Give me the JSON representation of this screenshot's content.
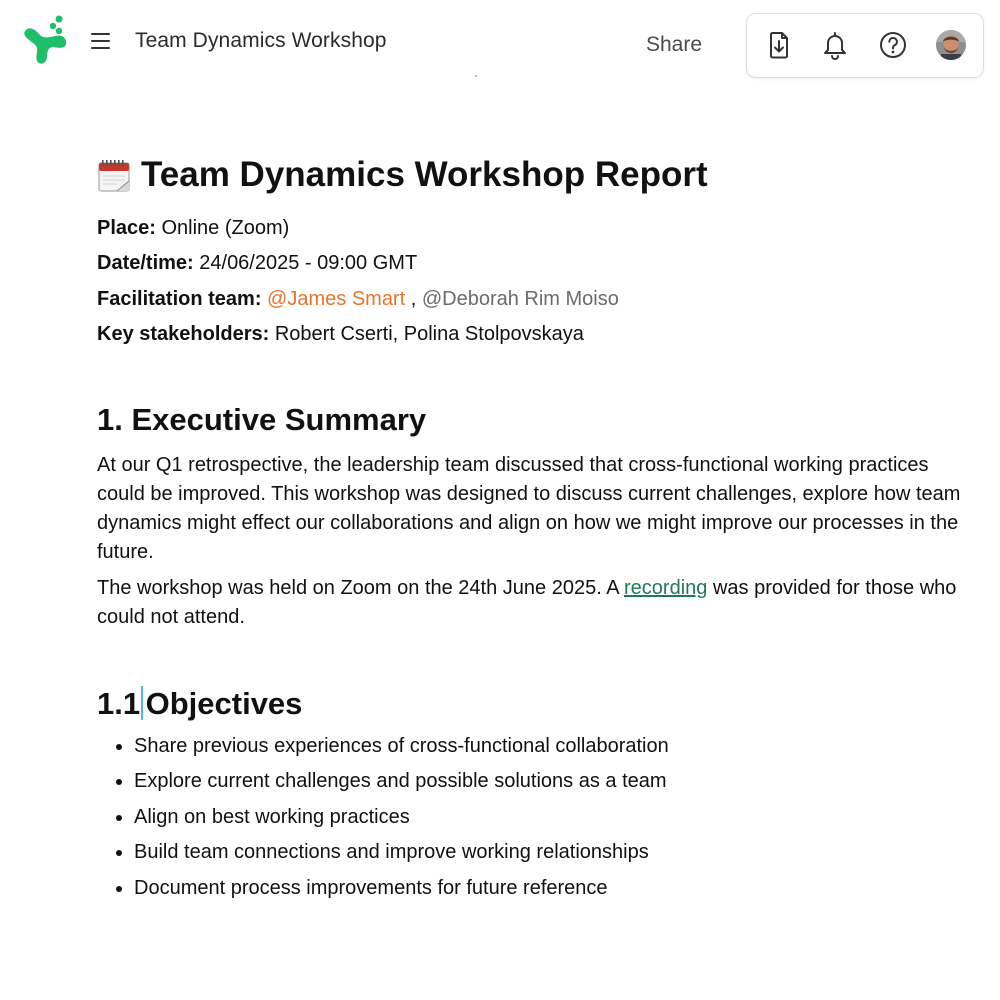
{
  "header": {
    "doc_title": "Team Dynamics Workshop",
    "share_label": "Share"
  },
  "document": {
    "title": "Team Dynamics Workshop Report",
    "meta": {
      "place_label": "Place:",
      "place_value": " Online (Zoom)",
      "datetime_label": "Date/time:",
      "datetime_value": " 24/06/2025 - 09:00 GMT",
      "facilitation_label": "Facilitation team:",
      "facilitator_1": "@James Smart",
      "separator": " , ",
      "facilitator_2": "@Deborah Rim Moiso",
      "stakeholders_label": "Key stakeholders:",
      "stakeholders_value": " Robert Cserti, Polina Stolpovskaya"
    },
    "section_1": {
      "heading": "1. Executive Summary",
      "paragraph_1": "At our Q1 retrospective, the leadership team discussed that cross-functional working practices could be improved. This workshop was designed to discuss current challenges, explore how team dynamics might effect our collaborations and align on how we might improve our processes in the future.",
      "paragraph_2_before": "The workshop was held on Zoom on the 24th June 2025. A ",
      "paragraph_2_link": "recording",
      "paragraph_2_after": " was provided for those who could not attend."
    },
    "section_1_1": {
      "heading_number": "1.1",
      "heading_text": "Objectives",
      "items": [
        "Share previous experiences of cross-functional collaboration",
        "Explore current challenges and possible solutions as a team",
        "Align on best working practices",
        "Build team connections and improve working relationships",
        "Document process improvements for future reference"
      ]
    }
  },
  "icons": {
    "logo": "app-logo",
    "menu": "hamburger-menu-icon",
    "download": "download-file-icon",
    "notifications": "bell-icon",
    "help": "help-icon",
    "title_emoji": "calendar-icon"
  },
  "colors": {
    "brand_green": "#1fbf6a",
    "mention_active": "#e8742a",
    "mention_inactive": "#6b6b6b",
    "link": "#1f7a54"
  }
}
